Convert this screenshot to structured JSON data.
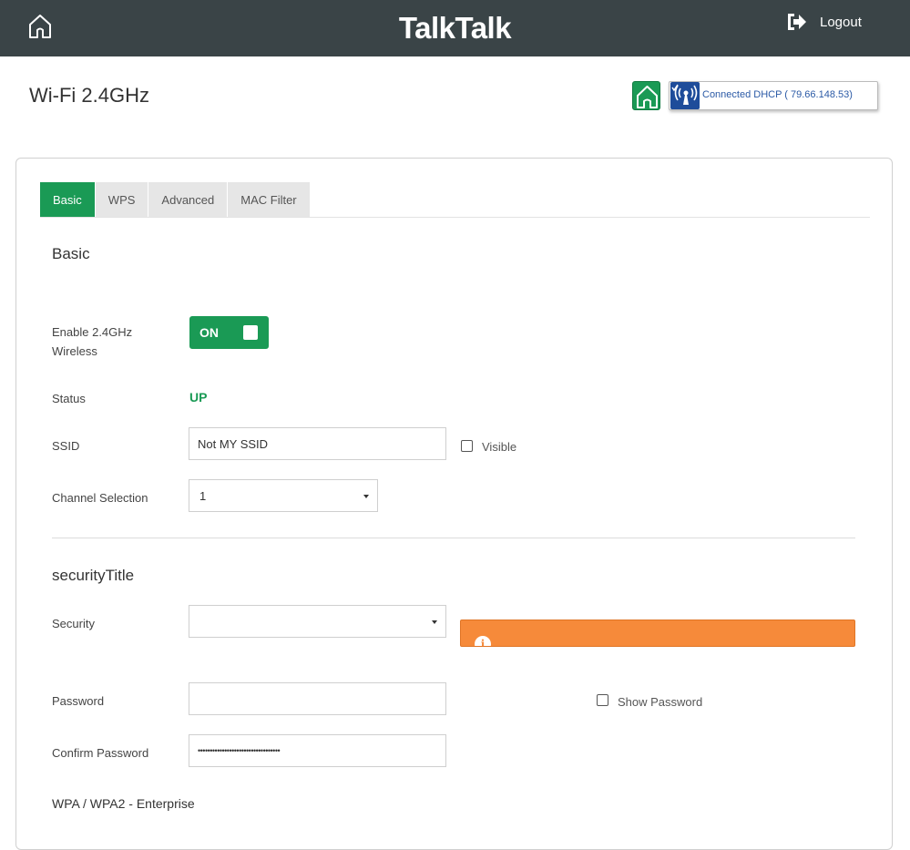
{
  "header": {
    "brand": "TalkTalk",
    "logout_label": "Logout"
  },
  "page": {
    "title": "Wi-Fi 2.4GHz",
    "connection_text": "Connected DHCP ( 79.66.148.53)"
  },
  "tabs": [
    {
      "label": "Basic",
      "active": true
    },
    {
      "label": "WPS",
      "active": false
    },
    {
      "label": "Advanced",
      "active": false
    },
    {
      "label": "MAC Filter",
      "active": false
    }
  ],
  "basic": {
    "title": "Basic",
    "enable_label_line1": "Enable 2.4GHz",
    "enable_label_line2": "Wireless",
    "toggle_state": "ON",
    "status_label": "Status",
    "status_value": "UP",
    "ssid_label": "SSID",
    "ssid_value": "Not MY SSID",
    "visible_label": "Visible",
    "channel_label": "Channel Selection",
    "channel_value": "1"
  },
  "security": {
    "title": "securityTitle",
    "security_label": "Security",
    "security_value": "",
    "password_label": "Password",
    "password_value": "",
    "show_password_label": "Show Password",
    "confirm_label": "Confirm Password",
    "confirm_value": "••••••••••••••••••••••••••••••••••",
    "enterprise_title": "WPA / WPA2 - Enterprise"
  },
  "colors": {
    "header_bg": "#3a4447",
    "accent_green": "#1a9a55",
    "warning_orange": "#f68a3a",
    "connection_blue": "#1e4c9a"
  }
}
